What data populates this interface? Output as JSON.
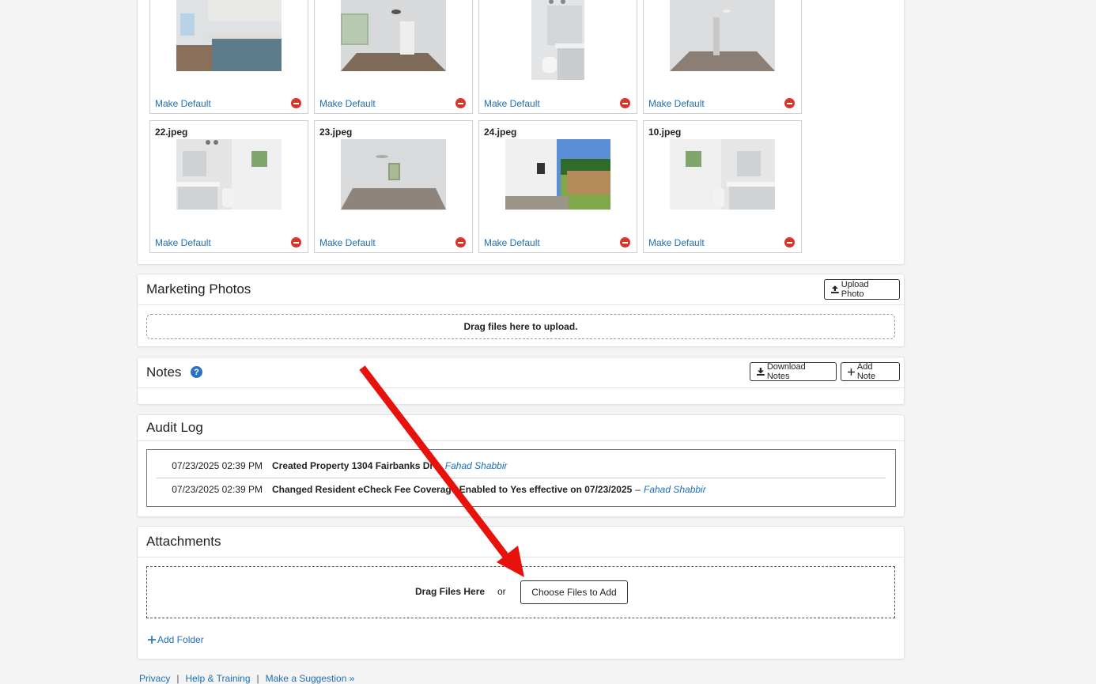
{
  "photos": {
    "tiles": [
      {
        "name": "",
        "make_default": "Make Default"
      },
      {
        "name": "",
        "make_default": "Make Default"
      },
      {
        "name": "",
        "make_default": "Make Default"
      },
      {
        "name": "",
        "make_default": "Make Default"
      },
      {
        "name": "22.jpeg",
        "make_default": "Make Default"
      },
      {
        "name": "23.jpeg",
        "make_default": "Make Default"
      },
      {
        "name": "24.jpeg",
        "make_default": "Make Default"
      },
      {
        "name": "10.jpeg",
        "make_default": "Make Default"
      }
    ]
  },
  "marketing": {
    "title": "Marketing Photos",
    "upload_button": "Upload Photo",
    "dropzone_text": "Drag files here to upload."
  },
  "notes": {
    "title": "Notes",
    "help": "?",
    "download_button": "Download Notes",
    "add_button": "Add Note"
  },
  "audit": {
    "title": "Audit Log",
    "entries": [
      {
        "date": "07/23/2025 02:39 PM",
        "message": "Created Property 1304 Fairbanks Dr",
        "separator": "–",
        "user": "Fahad Shabbir"
      },
      {
        "date": "07/23/2025 02:39 PM",
        "message": "Changed Resident eCheck Fee Coverage Enabled to Yes effective on 07/23/2025",
        "separator": "–",
        "user": "Fahad Shabbir"
      }
    ]
  },
  "attachments": {
    "title": "Attachments",
    "drag_text": "Drag Files Here",
    "or_text": "or",
    "choose_button": "Choose Files to Add",
    "add_folder": "Add Folder"
  },
  "footer": {
    "links": [
      "Privacy",
      "Help & Training",
      "Make a Suggestion »"
    ],
    "separator": "|"
  },
  "colors": {
    "link": "#1d6fb8",
    "remove": "#d9342b",
    "annotation_arrow": "#e8120c"
  },
  "icons": [
    "remove-icon",
    "upload-icon",
    "help-icon",
    "download-icon",
    "plus-icon",
    "annotation-arrow"
  ]
}
